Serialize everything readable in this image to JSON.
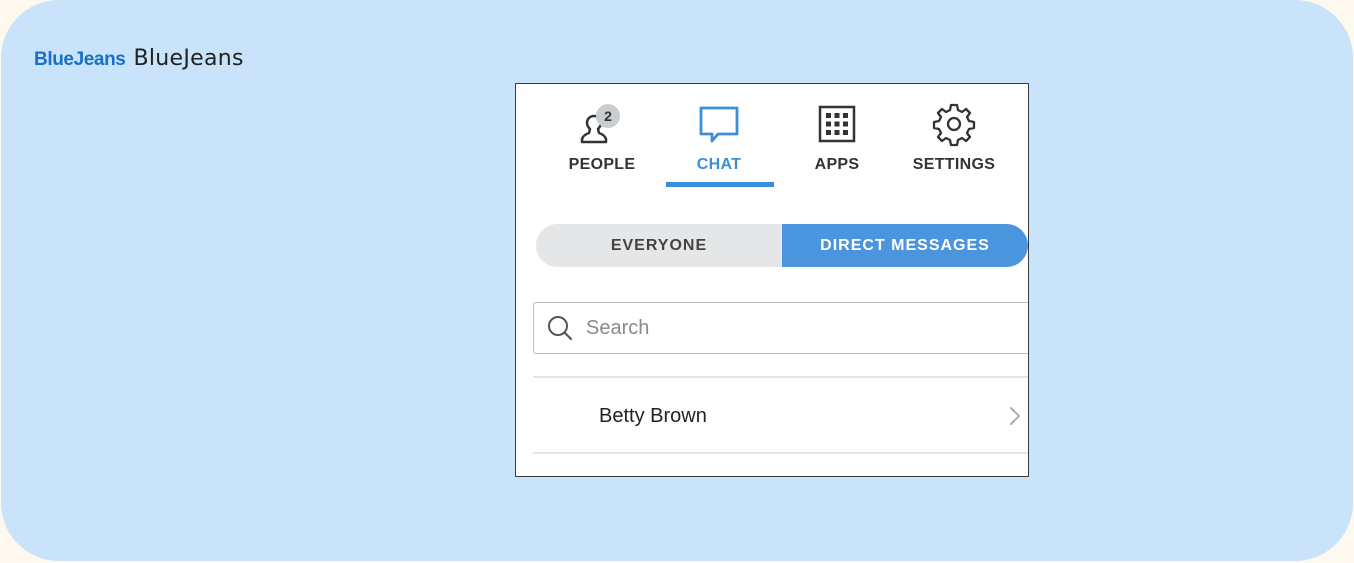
{
  "brand": {
    "logo_text": "BlueJeans",
    "name_text": "BlueJeans",
    "logo_color": "#1a6fc9"
  },
  "tabs": [
    {
      "label": "PEOPLE",
      "icon": "people-icon",
      "badge": "2",
      "active": false
    },
    {
      "label": "CHAT",
      "icon": "chat-icon",
      "active": true
    },
    {
      "label": "APPS",
      "icon": "apps-grid-icon",
      "active": false
    },
    {
      "label": "SETTINGS",
      "icon": "gear-icon",
      "active": false
    }
  ],
  "segments": [
    {
      "label": "EVERYONE",
      "active": false
    },
    {
      "label": "DIRECT MESSAGES",
      "active": true
    }
  ],
  "search": {
    "placeholder": "Search",
    "value": ""
  },
  "conversations": [
    {
      "name": "Betty Brown"
    }
  ],
  "colors": {
    "accent": "#3b8fd9",
    "background": "#c9e4fa",
    "segment_active": "#4a95dd"
  }
}
